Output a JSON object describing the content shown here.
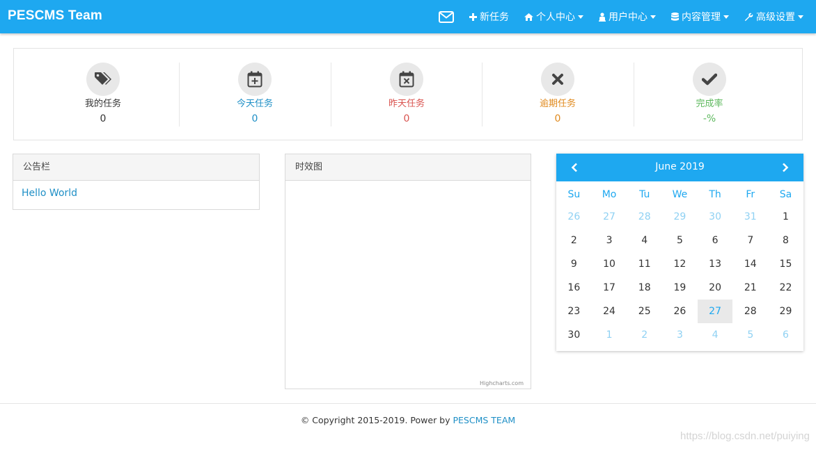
{
  "app": {
    "brand": "PESCMS Team"
  },
  "nav": {
    "mail_icon": "envelope-icon",
    "items": [
      {
        "label": "新任务",
        "icon": "plus-icon",
        "dropdown": false
      },
      {
        "label": "个人中心",
        "icon": "home-icon",
        "dropdown": true
      },
      {
        "label": "用户中心",
        "icon": "user-icon",
        "dropdown": true
      },
      {
        "label": "内容管理",
        "icon": "database-icon",
        "dropdown": true
      },
      {
        "label": "高级设置",
        "icon": "wrench-icon",
        "dropdown": true
      }
    ]
  },
  "stats": [
    {
      "label": "我的任务",
      "value": "0",
      "icon": "tags-icon",
      "color": "#333333"
    },
    {
      "label": "今天任务",
      "value": "0",
      "icon": "calendar-plus-icon",
      "color": "#1e8fc6"
    },
    {
      "label": "昨天任务",
      "value": "0",
      "icon": "calendar-times-icon",
      "color": "#d9534f"
    },
    {
      "label": "逾期任务",
      "value": "0",
      "icon": "times-icon",
      "color": "#e08a1e"
    },
    {
      "label": "完成率",
      "value": "-%",
      "icon": "check-icon",
      "color": "#5cb85c"
    }
  ],
  "notice": {
    "title": "公告栏",
    "items": [
      "Hello World"
    ]
  },
  "timeline": {
    "title": "时效图",
    "credit": "Highcharts.com"
  },
  "calendar": {
    "title": "June 2019",
    "weekdays": [
      "Su",
      "Mo",
      "Tu",
      "We",
      "Th",
      "Fr",
      "Sa"
    ],
    "weeks": [
      [
        "26",
        "27",
        "28",
        "29",
        "30",
        "31",
        "1"
      ],
      [
        "2",
        "3",
        "4",
        "5",
        "6",
        "7",
        "8"
      ],
      [
        "9",
        "10",
        "11",
        "12",
        "13",
        "14",
        "15"
      ],
      [
        "16",
        "17",
        "18",
        "19",
        "20",
        "21",
        "22"
      ],
      [
        "23",
        "24",
        "25",
        "26",
        "27",
        "28",
        "29"
      ],
      [
        "30",
        "1",
        "2",
        "3",
        "4",
        "5",
        "6"
      ]
    ],
    "other_month": [
      [
        0,
        0
      ],
      [
        0,
        1
      ],
      [
        0,
        2
      ],
      [
        0,
        3
      ],
      [
        0,
        4
      ],
      [
        0,
        5
      ],
      [
        5,
        1
      ],
      [
        5,
        2
      ],
      [
        5,
        3
      ],
      [
        5,
        4
      ],
      [
        5,
        5
      ],
      [
        5,
        6
      ]
    ],
    "today": [
      4,
      4
    ]
  },
  "footer": {
    "text": "© Copyright 2015-2019. Power by ",
    "link": "PESCMS TEAM"
  },
  "watermark": "https://blog.csdn.net/puiying",
  "colors": {
    "primary": "#1ea8f0",
    "link": "#1e8fc6"
  }
}
